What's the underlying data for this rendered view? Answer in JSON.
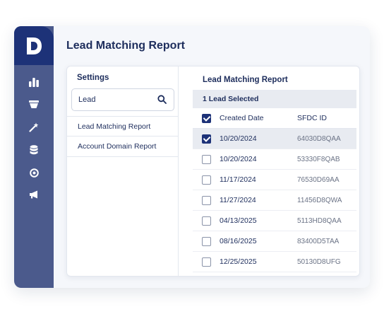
{
  "app": {
    "page_title": "Lead Matching Report",
    "logo_letter": "D",
    "rail_icons": [
      "bar-chart-icon",
      "funnel-icon",
      "magic-wand-icon",
      "database-icon",
      "target-icon",
      "megaphone-icon"
    ],
    "colors": {
      "brand": "#1d3278",
      "rail": "#4b5a8c",
      "text": "#1d2d5c"
    }
  },
  "settings": {
    "title": "Settings",
    "search": {
      "value": "Lead",
      "icon": "search-icon"
    },
    "items": [
      {
        "label": "Lead Matching Report",
        "active": true
      },
      {
        "label": "Account Domain Report",
        "active": false
      }
    ]
  },
  "report": {
    "title": "Lead Matching Report",
    "selected_text": "1 Lead Selected",
    "columns": {
      "date": "Created Date",
      "id": "SFDC ID"
    },
    "rows": [
      {
        "date": "10/20/2024",
        "id": "64030D8QAA",
        "checked": true
      },
      {
        "date": "10/20/2024",
        "id": "53330F8QAB",
        "checked": false
      },
      {
        "date": "11/17/2024",
        "id": "76530D69AA",
        "checked": false
      },
      {
        "date": "11/27/2024",
        "id": "11456D8QWA",
        "checked": false
      },
      {
        "date": "04/13/2025",
        "id": "5113HD8QAA",
        "checked": false
      },
      {
        "date": "08/16/2025",
        "id": "83400D5TAA",
        "checked": false
      },
      {
        "date": "12/25/2025",
        "id": "50130D8UFG",
        "checked": false
      }
    ]
  }
}
